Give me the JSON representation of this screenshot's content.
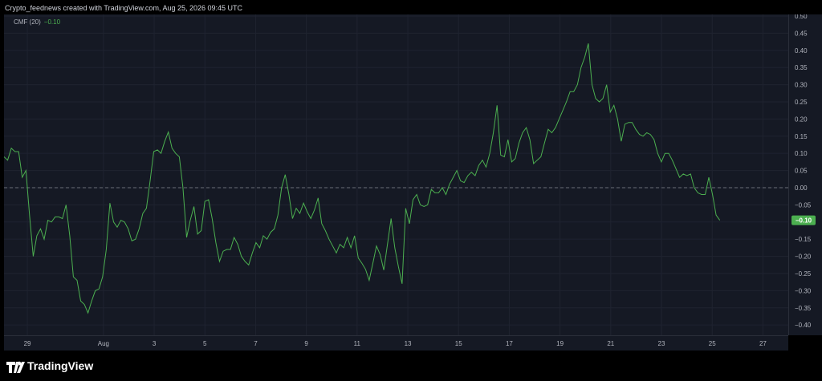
{
  "header": {
    "attribution": "Crypto_feednews created with TradingView.com, Aug 25, 2026 09:45 UTC"
  },
  "legend": {
    "name": "CMF (20)",
    "value": "−0.10"
  },
  "last_value_label": "−0.10",
  "footer": {
    "brand": "TradingView"
  },
  "colors": {
    "line": "#4caf50",
    "badge": "#4caf50",
    "background": "#151924",
    "zero_line": "#6b6f78"
  },
  "chart_data": {
    "type": "line",
    "title": "",
    "series": [
      {
        "name": "CMF (20)",
        "values": [
          0.09,
          0.08,
          0.115,
          0.105,
          0.105,
          0.03,
          0.05,
          -0.08,
          -0.2,
          -0.14,
          -0.12,
          -0.15,
          -0.095,
          -0.1,
          -0.085,
          -0.085,
          -0.09,
          -0.05,
          -0.14,
          -0.26,
          -0.27,
          -0.33,
          -0.34,
          -0.365,
          -0.33,
          -0.3,
          -0.295,
          -0.26,
          -0.18,
          -0.045,
          -0.1,
          -0.115,
          -0.095,
          -0.1,
          -0.12,
          -0.155,
          -0.15,
          -0.12,
          -0.075,
          -0.06,
          0.02,
          0.105,
          0.11,
          0.1,
          0.135,
          0.162,
          0.115,
          0.1,
          0.09,
          0.0,
          -0.145,
          -0.095,
          -0.055,
          -0.135,
          -0.125,
          -0.04,
          -0.035,
          -0.09,
          -0.16,
          -0.215,
          -0.185,
          -0.18,
          -0.18,
          -0.145,
          -0.165,
          -0.2,
          -0.215,
          -0.225,
          -0.19,
          -0.16,
          -0.175,
          -0.14,
          -0.15,
          -0.13,
          -0.12,
          -0.08,
          0.0,
          0.038,
          -0.02,
          -0.09,
          -0.06,
          -0.075,
          -0.045,
          -0.07,
          -0.09,
          -0.065,
          -0.03,
          -0.105,
          -0.125,
          -0.15,
          -0.17,
          -0.19,
          -0.165,
          -0.175,
          -0.145,
          -0.175,
          -0.14,
          -0.205,
          -0.22,
          -0.238,
          -0.27,
          -0.22,
          -0.17,
          -0.195,
          -0.24,
          -0.165,
          -0.09,
          -0.175,
          -0.23,
          -0.28,
          -0.06,
          -0.105,
          -0.035,
          -0.02,
          -0.05,
          -0.055,
          -0.05,
          -0.005,
          -0.015,
          -0.015,
          0.0,
          -0.02,
          0.01,
          0.03,
          0.05,
          0.02,
          0.015,
          0.035,
          0.045,
          0.035,
          0.065,
          0.08,
          0.06,
          0.1,
          0.16,
          0.24,
          0.095,
          0.09,
          0.14,
          0.075,
          0.085,
          0.13,
          0.16,
          0.175,
          0.14,
          0.07,
          0.08,
          0.09,
          0.13,
          0.17,
          0.16,
          0.175,
          0.2,
          0.225,
          0.25,
          0.28,
          0.28,
          0.3,
          0.35,
          0.38,
          0.42,
          0.3,
          0.26,
          0.25,
          0.26,
          0.3,
          0.22,
          0.24,
          0.2,
          0.135,
          0.185,
          0.19,
          0.19,
          0.17,
          0.155,
          0.15,
          0.16,
          0.155,
          0.14,
          0.1,
          0.075,
          0.1,
          0.1,
          0.08,
          0.055,
          0.03,
          0.04,
          0.035,
          0.04,
          0.0,
          -0.015,
          -0.02,
          -0.02,
          0.03,
          -0.02,
          -0.08,
          -0.095
        ]
      }
    ],
    "x_ticks": [
      {
        "label": "29",
        "day": 29
      },
      {
        "label": "Aug",
        "day": 32
      },
      {
        "label": "3",
        "day": 34
      },
      {
        "label": "5",
        "day": 36
      },
      {
        "label": "7",
        "day": 38
      },
      {
        "label": "9",
        "day": 40
      },
      {
        "label": "11",
        "day": 42
      },
      {
        "label": "13",
        "day": 44
      },
      {
        "label": "15",
        "day": 46
      },
      {
        "label": "17",
        "day": 48
      },
      {
        "label": "19",
        "day": 50
      },
      {
        "label": "21",
        "day": 52
      },
      {
        "label": "23",
        "day": 54
      },
      {
        "label": "25",
        "day": 56
      },
      {
        "label": "27",
        "day": 58
      }
    ],
    "x_range_days": [
      28.08,
      59.0
    ],
    "series_start_day": 28.08,
    "series_end_day": 56.3,
    "y_ticks": [
      "0.50",
      "0.45",
      "0.40",
      "0.35",
      "0.30",
      "0.25",
      "0.20",
      "0.15",
      "0.10",
      "0.05",
      "0.00",
      "−0.05",
      "−0.10",
      "−0.15",
      "−0.20",
      "−0.25",
      "−0.30",
      "−0.35",
      "−0.40"
    ],
    "ylim": [
      -0.43,
      0.5
    ],
    "zero_line": "dashed",
    "grid": true
  }
}
